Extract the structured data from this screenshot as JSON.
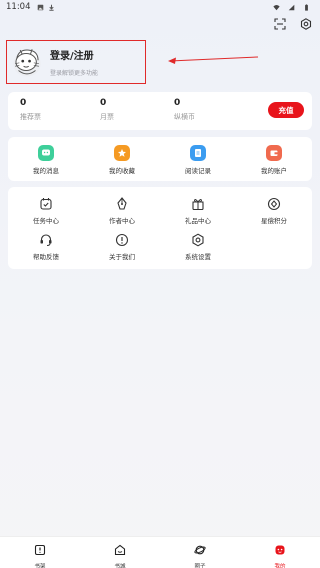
{
  "status_bar": {
    "time": "11:04"
  },
  "profile": {
    "name": "登录/注册",
    "subtitle": "登录解锁更多功能"
  },
  "stats": [
    {
      "value": "0",
      "label": "推荐票"
    },
    {
      "value": "0",
      "label": "月票"
    },
    {
      "value": "0",
      "label": "纵横币"
    }
  ],
  "recharge_label": "充值",
  "quick": [
    {
      "label": "我的消息",
      "icon": "message-icon",
      "color": "#3ecf9a"
    },
    {
      "label": "我的收藏",
      "icon": "star-icon",
      "color": "#f59a23"
    },
    {
      "label": "阅读记录",
      "icon": "reading-record-icon",
      "color": "#3b9cf0"
    },
    {
      "label": "我的账户",
      "icon": "wallet-icon",
      "color": "#f06a4e"
    }
  ],
  "tools": [
    {
      "label": "任务中心",
      "icon": "task-icon"
    },
    {
      "label": "作者中心",
      "icon": "pen-icon"
    },
    {
      "label": "礼品中心",
      "icon": "gift-icon"
    },
    {
      "label": "星偿积分",
      "icon": "points-icon"
    },
    {
      "label": "帮助反馈",
      "icon": "headset-icon"
    },
    {
      "label": "关于我们",
      "icon": "info-icon"
    },
    {
      "label": "系统设置",
      "icon": "settings-icon"
    }
  ],
  "tabs": [
    {
      "label": "书架",
      "icon": "bookshelf-icon"
    },
    {
      "label": "书城",
      "icon": "bookstore-icon"
    },
    {
      "label": "圈子",
      "icon": "planet-icon"
    },
    {
      "label": "我的",
      "icon": "me-icon",
      "active": true
    }
  ],
  "colors": {
    "accent": "#e8141b",
    "annotation": "#e02a2a"
  }
}
